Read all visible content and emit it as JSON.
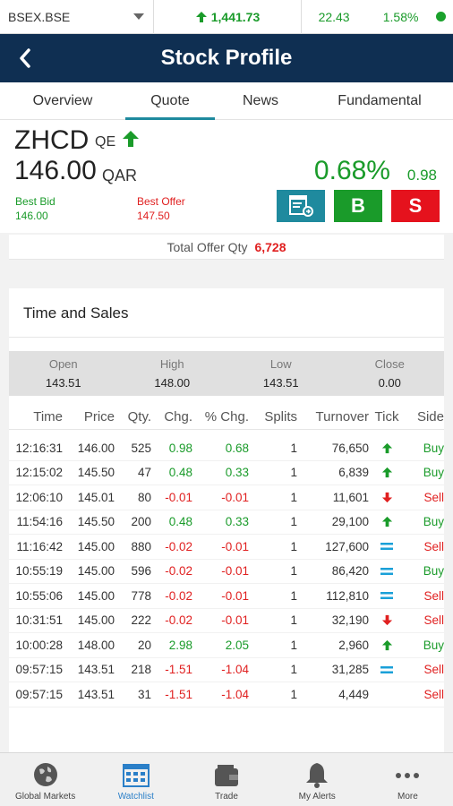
{
  "topbar": {
    "exchange": "BSEX.BSE",
    "index_value": "1,441.73",
    "change": "22.43",
    "change_pct": "1.58%"
  },
  "header": {
    "title": "Stock Profile"
  },
  "tabs": [
    {
      "label": "Overview"
    },
    {
      "label": "Quote"
    },
    {
      "label": "News"
    },
    {
      "label": "Fundamental"
    }
  ],
  "quote": {
    "symbol": "ZHCD",
    "market": "QE",
    "price": "146.00",
    "currency": "QAR",
    "change_pct": "0.68%",
    "change": "0.98",
    "best_bid_label": "Best Bid",
    "best_bid": "146.00",
    "best_offer_label": "Best Offer",
    "best_offer": "147.50",
    "buy_label": "B",
    "sell_label": "S"
  },
  "offer": {
    "label": "Total Offer Qty",
    "value": "6,728"
  },
  "time_sales": {
    "title": "Time and Sales",
    "summary": [
      {
        "label": "Open",
        "value": "143.51"
      },
      {
        "label": "High",
        "value": "148.00"
      },
      {
        "label": "Low",
        "value": "143.51"
      },
      {
        "label": "Close",
        "value": "0.00"
      }
    ],
    "headers": [
      "Time",
      "Price",
      "Qty.",
      "Chg.",
      "% Chg.",
      "Splits",
      "Turnover",
      "Tick",
      "Side"
    ],
    "rows": [
      {
        "time": "12:16:31",
        "price": "146.00",
        "qty": "525",
        "chg": "0.98",
        "pchg": "0.68",
        "splits": "1",
        "turnover": "76,650",
        "tick": "up",
        "side": "Buy"
      },
      {
        "time": "12:15:02",
        "price": "145.50",
        "qty": "47",
        "chg": "0.48",
        "pchg": "0.33",
        "splits": "1",
        "turnover": "6,839",
        "tick": "up",
        "side": "Buy"
      },
      {
        "time": "12:06:10",
        "price": "145.01",
        "qty": "80",
        "chg": "-0.01",
        "pchg": "-0.01",
        "splits": "1",
        "turnover": "11,601",
        "tick": "down",
        "side": "Sell"
      },
      {
        "time": "11:54:16",
        "price": "145.50",
        "qty": "200",
        "chg": "0.48",
        "pchg": "0.33",
        "splits": "1",
        "turnover": "29,100",
        "tick": "up",
        "side": "Buy"
      },
      {
        "time": "11:16:42",
        "price": "145.00",
        "qty": "880",
        "chg": "-0.02",
        "pchg": "-0.01",
        "splits": "1",
        "turnover": "127,600",
        "tick": "equal",
        "side": "Sell"
      },
      {
        "time": "10:55:19",
        "price": "145.00",
        "qty": "596",
        "chg": "-0.02",
        "pchg": "-0.01",
        "splits": "1",
        "turnover": "86,420",
        "tick": "equal",
        "side": "Buy"
      },
      {
        "time": "10:55:06",
        "price": "145.00",
        "qty": "778",
        "chg": "-0.02",
        "pchg": "-0.01",
        "splits": "1",
        "turnover": "112,810",
        "tick": "equal",
        "side": "Sell"
      },
      {
        "time": "10:31:51",
        "price": "145.00",
        "qty": "222",
        "chg": "-0.02",
        "pchg": "-0.01",
        "splits": "1",
        "turnover": "32,190",
        "tick": "down",
        "side": "Sell"
      },
      {
        "time": "10:00:28",
        "price": "148.00",
        "qty": "20",
        "chg": "2.98",
        "pchg": "2.05",
        "splits": "1",
        "turnover": "2,960",
        "tick": "up",
        "side": "Buy"
      },
      {
        "time": "09:57:15",
        "price": "143.51",
        "qty": "218",
        "chg": "-1.51",
        "pchg": "-1.04",
        "splits": "1",
        "turnover": "31,285",
        "tick": "equal",
        "side": "Sell"
      },
      {
        "time": "09:57:15",
        "price": "143.51",
        "qty": "31",
        "chg": "-1.51",
        "pchg": "-1.04",
        "splits": "1",
        "turnover": "4,449",
        "tick": "none",
        "side": "Sell"
      }
    ]
  },
  "bottom_nav": [
    {
      "label": "Global Markets",
      "icon": "globe-icon"
    },
    {
      "label": "Watchlist",
      "icon": "watchlist-icon"
    },
    {
      "label": "Trade",
      "icon": "wallet-icon"
    },
    {
      "label": "My Alerts",
      "icon": "bell-icon"
    },
    {
      "label": "More",
      "icon": "more-icon"
    }
  ],
  "colors": {
    "header": "#0f2f52",
    "accent": "#1f8a9e",
    "positive": "#1a9b2a",
    "negative": "#e02020"
  }
}
